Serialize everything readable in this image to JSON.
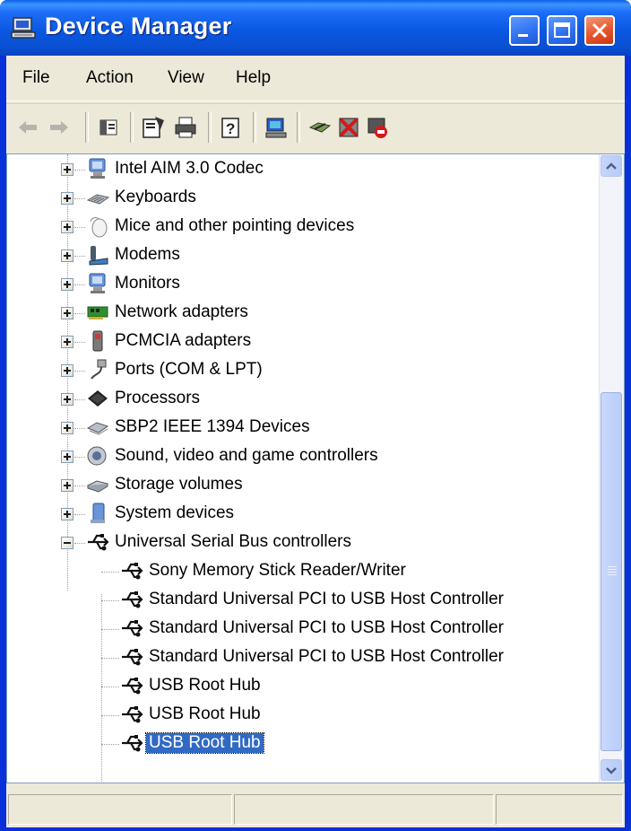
{
  "window": {
    "title": "Device Manager",
    "controls": {
      "minimize": "minimize",
      "maximize": "maximize",
      "close": "close"
    }
  },
  "menu": [
    "File",
    "Action",
    "View",
    "Help"
  ],
  "toolbar": {
    "buttons": [
      "back-icon",
      "forward-icon",
      "show-hide-console-tree-icon",
      "properties-icon",
      "print-icon",
      "help-icon",
      "scan-hardware-icon",
      "update-driver-icon",
      "uninstall-icon",
      "disable-icon"
    ]
  },
  "tree": {
    "categories": [
      {
        "label": "Intel AIM 3.0 Codec",
        "icon": "monitor-icon"
      },
      {
        "label": "Keyboards",
        "icon": "keyboard-icon"
      },
      {
        "label": "Mice and other pointing devices",
        "icon": "mouse-icon"
      },
      {
        "label": "Modems",
        "icon": "modem-icon"
      },
      {
        "label": "Monitors",
        "icon": "monitor-icon"
      },
      {
        "label": "Network adapters",
        "icon": "network-adapter-icon"
      },
      {
        "label": "PCMCIA adapters",
        "icon": "pcmcia-icon"
      },
      {
        "label": "Ports (COM & LPT)",
        "icon": "port-icon"
      },
      {
        "label": "Processors",
        "icon": "processor-icon"
      },
      {
        "label": "SBP2 IEEE 1394 Devices",
        "icon": "ieee1394-icon"
      },
      {
        "label": "Sound, video and game controllers",
        "icon": "sound-icon"
      },
      {
        "label": "Storage volumes",
        "icon": "storage-icon"
      },
      {
        "label": "System devices",
        "icon": "system-icon"
      },
      {
        "label": "Universal Serial Bus controllers",
        "icon": "usb-icon",
        "expanded": true
      }
    ],
    "usb_children": [
      {
        "label": "Sony Memory Stick Reader/Writer"
      },
      {
        "label": "Standard Universal PCI to USB Host Controller"
      },
      {
        "label": "Standard Universal PCI to USB Host Controller"
      },
      {
        "label": "Standard Universal PCI to USB Host Controller"
      },
      {
        "label": "USB Root Hub"
      },
      {
        "label": "USB Root Hub"
      },
      {
        "label": "USB Root Hub",
        "selected": true
      }
    ]
  },
  "colors": {
    "titlebar": "#0a58e2",
    "selection": "#316ac5",
    "chrome": "#ece9d8"
  }
}
